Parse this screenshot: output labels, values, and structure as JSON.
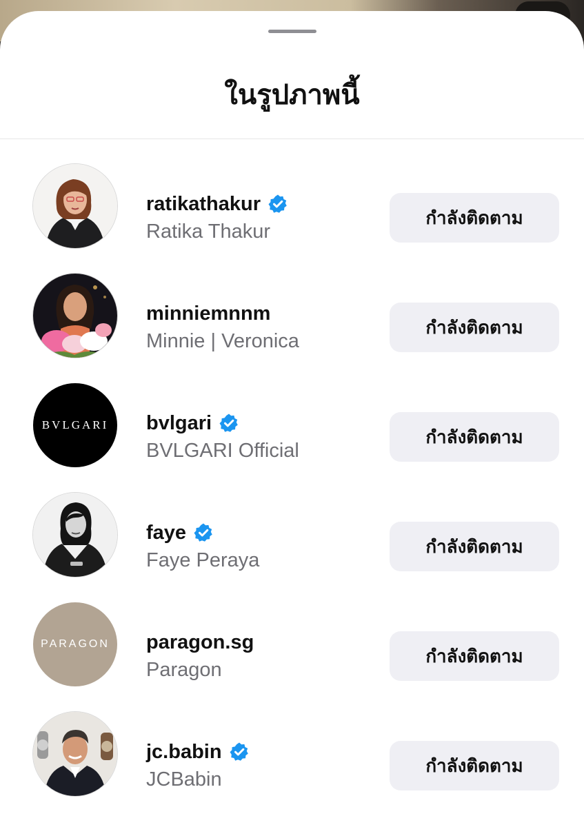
{
  "header": {
    "title": "ในรูปภาพนี้"
  },
  "accent_color": "#1b95f0",
  "people": [
    {
      "username": "ratikathakur",
      "full_name": "Ratika Thakur",
      "verified": true,
      "button_label": "กำลังติดตาม",
      "avatar": "photo-woman-black-blazer"
    },
    {
      "username": "minniemnnm",
      "full_name": "Minnie | Veronica",
      "verified": false,
      "button_label": "กำลังติดตาม",
      "avatar": "photo-woman-flowers"
    },
    {
      "username": "bvlgari",
      "full_name": "BVLGARI Official",
      "verified": true,
      "button_label": "กำลังติดตาม",
      "avatar": "bvlgari-logo",
      "avatar_text": "BVLGARI"
    },
    {
      "username": "faye",
      "full_name": "Faye Peraya",
      "verified": true,
      "button_label": "กำลังติดตาม",
      "avatar": "photo-woman-monochrome"
    },
    {
      "username": "paragon.sg",
      "full_name": "Paragon",
      "verified": false,
      "button_label": "กำลังติดตาม",
      "avatar": "paragon-logo",
      "avatar_text": "PARAGON"
    },
    {
      "username": "jc.babin",
      "full_name": "JCBabin",
      "verified": true,
      "button_label": "กำลังติดตาม",
      "avatar": "photo-man-suit"
    }
  ]
}
